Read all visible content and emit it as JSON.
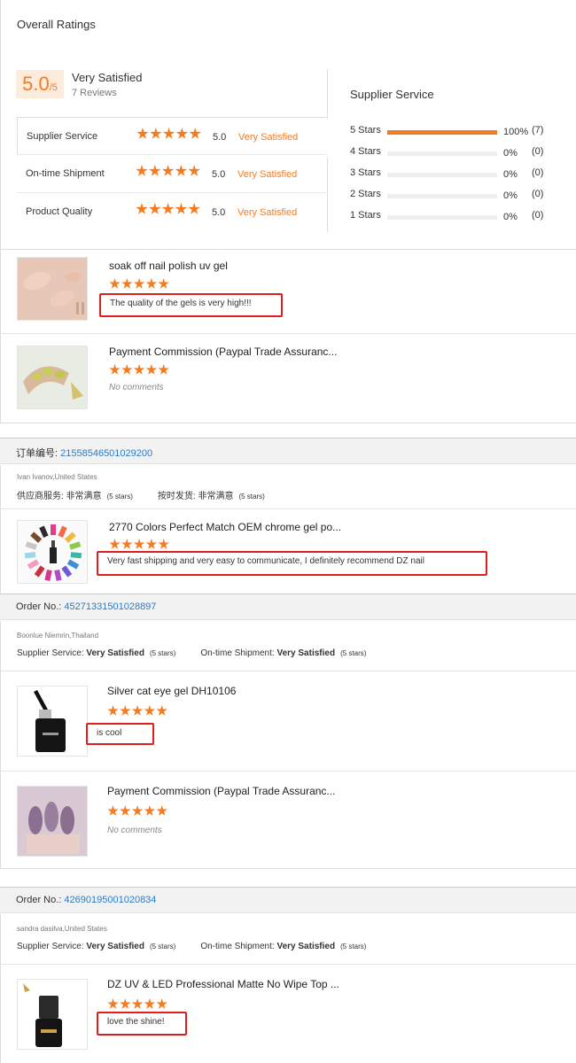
{
  "ratings": {
    "title": "Overall Ratings",
    "score_big": "5.0",
    "score_small": "/5",
    "overall_label": "Very Satisfied",
    "review_count": "7 Reviews",
    "dimensions": [
      {
        "name": "Supplier Service",
        "score": "5.0",
        "label": "Very Satisfied",
        "stars": 5
      },
      {
        "name": "On-time Shipment",
        "score": "5.0",
        "label": "Very Satisfied",
        "stars": 5
      },
      {
        "name": "Product Quality",
        "score": "5.0",
        "label": "Very Satisfied",
        "stars": 5
      }
    ],
    "service_title": "Supplier Service",
    "breakdown": [
      {
        "label": "5 Stars",
        "pct": "100%",
        "count": "(7)",
        "fill": 1.0
      },
      {
        "label": "4 Stars",
        "pct": "0%",
        "count": "(0)",
        "fill": 0
      },
      {
        "label": "3 Stars",
        "pct": "0%",
        "count": "(0)",
        "fill": 0
      },
      {
        "label": "2 Stars",
        "pct": "0%",
        "count": "(0)",
        "fill": 0
      },
      {
        "label": "1 Stars",
        "pct": "0%",
        "count": "(0)",
        "fill": 0
      }
    ],
    "accent": "#f57b20"
  },
  "block1": {
    "items": [
      {
        "title": "soak off nail polish uv gel",
        "stars": 5,
        "comment": "The quality of the gels is very high!!!"
      },
      {
        "title": "Payment Commission (Paypal Trade Assuranc...",
        "stars": 5,
        "comment": "No comments"
      }
    ]
  },
  "block2": {
    "order_label": "订单编号:",
    "order_no": "21558546501029200",
    "buyer": "Ivan Ivanov,United States",
    "meta_service_label": "供应商服务:",
    "meta_service_value": "非常满意",
    "meta_service_stars": "(5 stars)",
    "meta_ship_label": "按时发货:",
    "meta_ship_value": "非常满意",
    "meta_ship_stars": "(5 stars)",
    "items": [
      {
        "title": "2770 Colors Perfect Match OEM chrome gel po...",
        "stars": 5,
        "comment": "Very fast shipping and very easy to communicate, I definitely recommend DZ nail"
      }
    ]
  },
  "block3": {
    "order_label": "Order No.:",
    "order_no": "45271331501028897",
    "buyer": "Boonlue Niemrin,Thailand",
    "meta_service_label": "Supplier Service:",
    "meta_service_value": "Very Satisfied",
    "meta_service_stars": "(5 stars)",
    "meta_ship_label": "On-time Shipment:",
    "meta_ship_value": "Very Satisfied",
    "meta_ship_stars": "(5 stars)",
    "items": [
      {
        "title": "Silver cat eye gel DH10106",
        "stars": 5,
        "comment": "is cool"
      },
      {
        "title": "Payment Commission (Paypal Trade Assuranc...",
        "stars": 5,
        "comment": "No comments"
      }
    ]
  },
  "block4": {
    "order_label": "Order No.:",
    "order_no": "42690195001020834",
    "buyer": "sandra dasilva,United States",
    "meta_service_label": "Supplier Service:",
    "meta_service_value": "Very Satisfied",
    "meta_service_stars": "(5 stars)",
    "meta_ship_label": "On-time Shipment:",
    "meta_ship_value": "Very Satisfied",
    "meta_ship_stars": "(5 stars)",
    "items": [
      {
        "title": "DZ UV & LED Professional Matte No Wipe Top ...",
        "stars": 5,
        "comment": "love the shine!"
      }
    ]
  }
}
